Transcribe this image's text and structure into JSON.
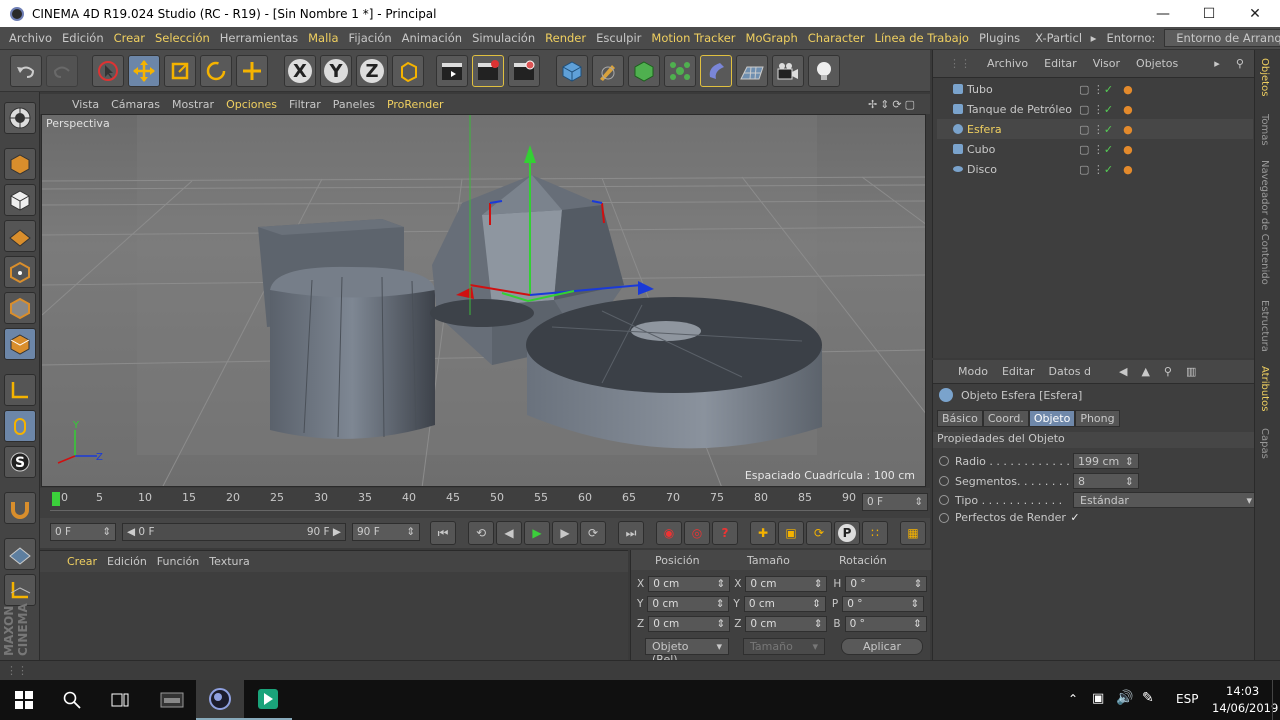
{
  "window": {
    "title": "CINEMA 4D R19.024 Studio (RC - R19) - [Sin Nombre 1 *] - Principal"
  },
  "menubar": {
    "items": [
      "Archivo",
      "Edición",
      "Crear",
      "Selección",
      "Herramientas",
      "Malla",
      "Fijación",
      "Animación",
      "Simulación",
      "Render",
      "Esculpir",
      "Motion Tracker",
      "MoGraph",
      "Character",
      "Línea de Trabajo",
      "Plugins",
      "X-Particl"
    ],
    "highlighted": [
      "Crear",
      "Selección",
      "Malla",
      "Render",
      "Motion Tracker",
      "MoGraph",
      "Character",
      "Línea de Trabajo"
    ],
    "env_label": "Entorno:",
    "env_value": "Entorno de Arranque"
  },
  "toolbar": {
    "axis_x": "X",
    "axis_y": "Y",
    "axis_z": "Z"
  },
  "viewport": {
    "menu": [
      "Vista",
      "Cámaras",
      "Mostrar",
      "Opciones",
      "Filtrar",
      "Paneles",
      "ProRender"
    ],
    "camera_label": "Perspectiva",
    "grid_spacing": "Espaciado Cuadrícula : 100 cm"
  },
  "timeline": {
    "ticks": [
      "0",
      "5",
      "10",
      "15",
      "20",
      "25",
      "30",
      "35",
      "40",
      "45",
      "50",
      "55",
      "60",
      "65",
      "70",
      "75",
      "80",
      "85",
      "90"
    ],
    "current_frame": "0 F"
  },
  "transport": {
    "start": "0 F",
    "range_start": "0 F",
    "range_end": "90 F",
    "end": "90 F"
  },
  "material_manager": {
    "menu": [
      "Crear",
      "Edición",
      "Función",
      "Textura"
    ]
  },
  "coordinates": {
    "headers": [
      "Posición",
      "Tamaño",
      "Rotación"
    ],
    "rows": [
      {
        "axis": "X",
        "pos": "0 cm",
        "size_axis": "X",
        "size": "0 cm",
        "rot_axis": "H",
        "rot": "0 °"
      },
      {
        "axis": "Y",
        "pos": "0 cm",
        "size_axis": "Y",
        "size": "0 cm",
        "rot_axis": "P",
        "rot": "0 °"
      },
      {
        "axis": "Z",
        "pos": "0 cm",
        "size_axis": "Z",
        "size": "0 cm",
        "rot_axis": "B",
        "rot": "0 °"
      }
    ],
    "mode": "Objeto (Rel)",
    "size_mode": "Tamaño",
    "apply": "Aplicar"
  },
  "object_manager": {
    "menu": [
      "Archivo",
      "Editar",
      "Visor",
      "Objetos"
    ],
    "objects": [
      {
        "name": "Tubo",
        "selected": false
      },
      {
        "name": "Tanque de Petróleo",
        "selected": false
      },
      {
        "name": "Esfera",
        "selected": true
      },
      {
        "name": "Cubo",
        "selected": false
      },
      {
        "name": "Disco",
        "selected": false
      }
    ]
  },
  "attribute_manager": {
    "menu": [
      "Modo",
      "Editar",
      "Datos d"
    ],
    "header": "Objeto Esfera  [Esfera]",
    "tabs": [
      "Básico",
      "Coord.",
      "Objeto",
      "Phong"
    ],
    "active_tab": "Objeto",
    "section": "Propiedades del Objeto",
    "props": [
      {
        "label": "Radio . . . . . . . . . . . .",
        "value": "199 cm"
      },
      {
        "label": "Segmentos. . . . . . . .",
        "value": "8"
      },
      {
        "label": "Tipo  . . . . . . . . . . . .",
        "value": "Estándar"
      },
      {
        "label": "Perfectos de Render",
        "value": "✓"
      }
    ]
  },
  "side_tabs": [
    "Objetos",
    "Tomas",
    "Navegador de Contenido",
    "Estructura",
    "Atributos",
    "Capas"
  ],
  "branding": "MAXON CINEMA",
  "taskbar": {
    "lang": "ESP",
    "time": "14:03",
    "date": "14/06/2019"
  }
}
